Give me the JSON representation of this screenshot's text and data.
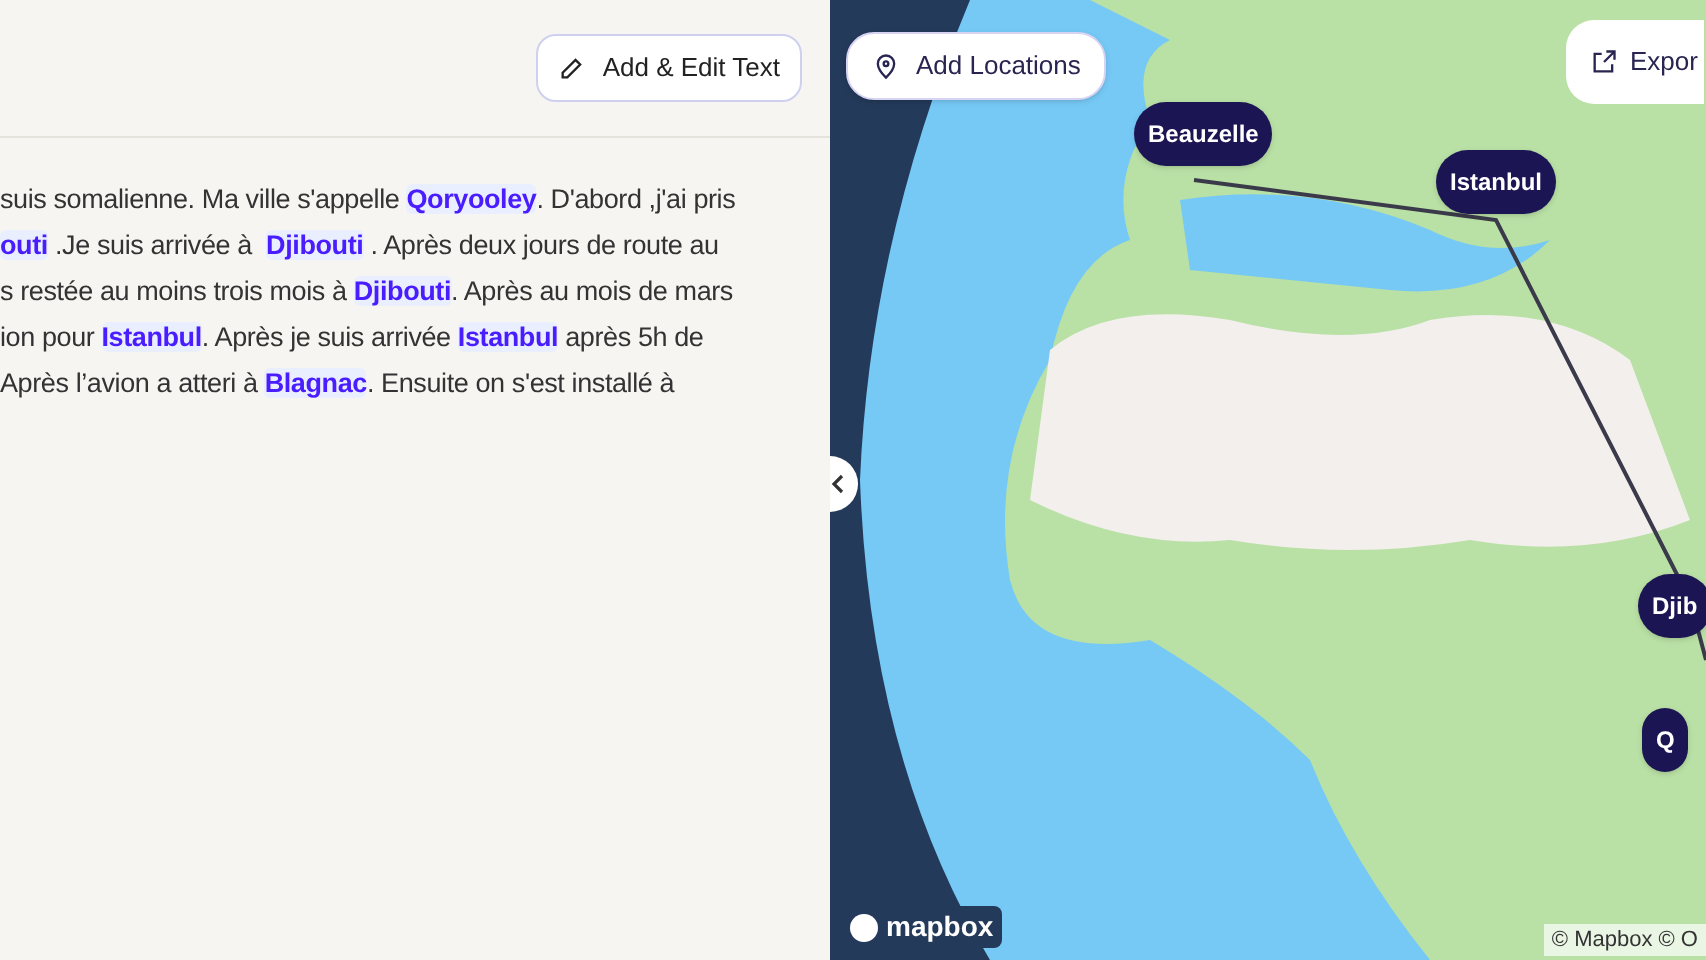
{
  "editor": {
    "edit_button": "Add & Edit Text",
    "lines": [
      [
        {
          "text": "suis somalienne. Ma ville s'appelle ",
          "place": false
        },
        {
          "text": "Qoryooley",
          "place": true
        },
        {
          "text": ". D'abord ,j'ai pris",
          "place": false
        }
      ],
      [
        {
          "text": "outi",
          "place": true
        },
        {
          "text": " .Je suis arrivée à  ",
          "place": false
        },
        {
          "text": "Djibouti",
          "place": true
        },
        {
          "text": " . Après deux jours de route au",
          "place": false
        }
      ],
      [
        {
          "text": "s restée au moins trois mois à ",
          "place": false
        },
        {
          "text": "Djibouti",
          "place": true
        },
        {
          "text": ". Après au mois de mars",
          "place": false
        }
      ],
      [
        {
          "text": "ion pour ",
          "place": false
        },
        {
          "text": "Istanbul",
          "place": true
        },
        {
          "text": ". Après je suis arrivée ",
          "place": false
        },
        {
          "text": "Istanbul",
          "place": true
        },
        {
          "text": " après 5h de",
          "place": false
        }
      ],
      [
        {
          "text": "Après l’avion a atteri à ",
          "place": false
        },
        {
          "text": "Blagnac",
          "place": true
        },
        {
          "text": ". Ensuite on s'est installé à",
          "place": false
        }
      ]
    ]
  },
  "map": {
    "add_button": "Add Locations",
    "export_button": "Expor",
    "markers": [
      {
        "label": "Beauzelle"
      },
      {
        "label": "Istanbul"
      },
      {
        "label": "Djib"
      },
      {
        "label": "Q"
      }
    ],
    "logo": "mapbox",
    "attribution": "© Mapbox © O"
  }
}
